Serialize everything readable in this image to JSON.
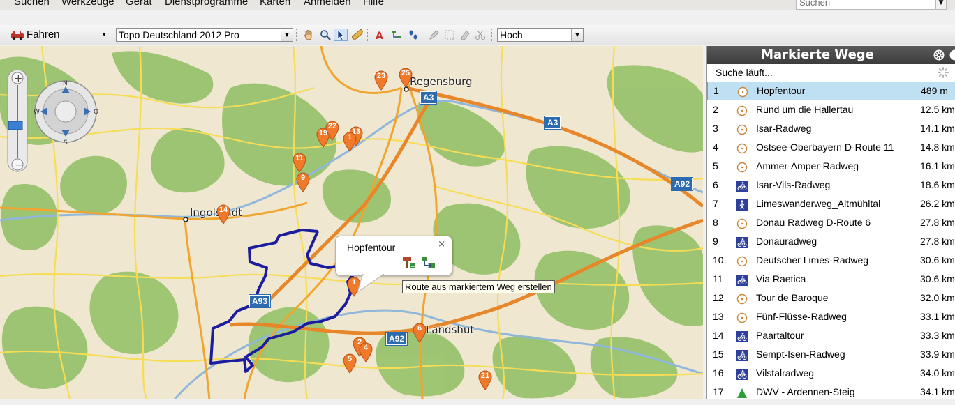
{
  "menu": [
    "Suchen",
    "Werkzeuge",
    "Gerät",
    "Dienstprogramme",
    "Karten",
    "Anmelden",
    "Hilfe"
  ],
  "search": {
    "placeholder": "Suchen"
  },
  "toolbar": {
    "mode": "Fahren",
    "map_product": "Topo Deutschland 2012 Pro",
    "detail": "Hoch"
  },
  "map": {
    "cities": [
      {
        "name": "Regensburg"
      },
      {
        "name": "Ingolstadt"
      },
      {
        "name": "Landshut"
      }
    ],
    "highway_shields": [
      "A3",
      "A3",
      "A92",
      "A93",
      "A92"
    ],
    "pins": [
      "23",
      "25",
      "19",
      "22",
      "13",
      "1",
      "11",
      "9",
      "14",
      "1",
      "6",
      "2",
      "4",
      "5",
      "21"
    ],
    "popup": {
      "title": "Hopfentour",
      "close": "×"
    },
    "tooltip": "Route aus markiertem Weg erstellen"
  },
  "panel": {
    "title": "Markierte Wege",
    "status": "Suche läuft...",
    "rows": [
      {
        "n": "1",
        "icon": "route-circle-icon",
        "name": "Hopfentour",
        "dist": "489 m"
      },
      {
        "n": "2",
        "icon": "route-circle-icon",
        "name": "Rund um die Hallertau",
        "dist": "12.5 km"
      },
      {
        "n": "3",
        "icon": "route-circle-icon",
        "name": "Isar-Radweg",
        "dist": "14.1 km"
      },
      {
        "n": "4",
        "icon": "route-circle-icon",
        "name": "Ostsee-Oberbayern D-Route 11",
        "dist": "14.8 km"
      },
      {
        "n": "5",
        "icon": "route-circle-icon",
        "name": "Ammer-Amper-Radweg",
        "dist": "16.1 km"
      },
      {
        "n": "6",
        "icon": "bicycle-icon",
        "name": "Isar-Vils-Radweg",
        "dist": "18.6 km"
      },
      {
        "n": "7",
        "icon": "hiker-icon",
        "name": "Limeswanderweg_Altmühltal",
        "dist": "26.2 km"
      },
      {
        "n": "8",
        "icon": "route-circle-icon",
        "name": "Donau Radweg D-Route 6",
        "dist": "27.8 km"
      },
      {
        "n": "9",
        "icon": "bicycle-icon",
        "name": "Donauradweg",
        "dist": "27.8 km"
      },
      {
        "n": "10",
        "icon": "route-circle-icon",
        "name": "Deutscher Limes-Radweg",
        "dist": "30.6 km"
      },
      {
        "n": "11",
        "icon": "bicycle-icon",
        "name": "Via Raetica",
        "dist": "30.6 km"
      },
      {
        "n": "12",
        "icon": "route-circle-icon",
        "name": "Tour de Baroque",
        "dist": "32.0 km"
      },
      {
        "n": "13",
        "icon": "route-circle-icon",
        "name": "Fünf-Flüsse-Radweg",
        "dist": "33.1 km"
      },
      {
        "n": "14",
        "icon": "bicycle-icon",
        "name": "Paartaltour",
        "dist": "33.3 km"
      },
      {
        "n": "15",
        "icon": "bicycle-icon",
        "name": "Sempt-Isen-Radweg",
        "dist": "33.9 km"
      },
      {
        "n": "16",
        "icon": "bicycle-icon",
        "name": "Vilstalradweg",
        "dist": "34.0 km"
      },
      {
        "n": "17",
        "icon": "triangle-icon",
        "name": "DWV - Ardennen-Steig",
        "dist": "34.1 km"
      }
    ]
  },
  "colors": {
    "route": "#1c1c9e",
    "pin": "#f07a2a",
    "selection": "#bfe0f3",
    "forest": "#8fbf63",
    "road": "#f5d53a"
  }
}
